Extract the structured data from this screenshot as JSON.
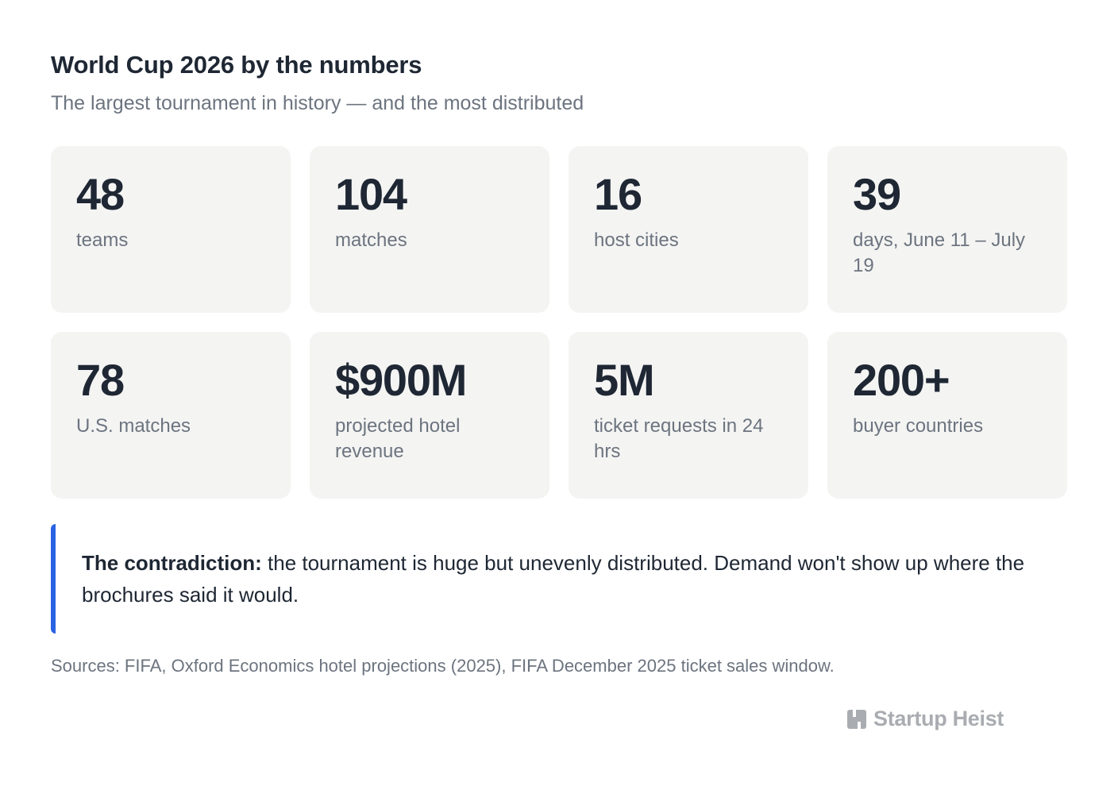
{
  "header": {
    "title": "World Cup 2026 by the numbers",
    "subtitle": "The largest tournament in history — and the most distributed"
  },
  "stats": [
    {
      "value": "48",
      "label": "teams"
    },
    {
      "value": "104",
      "label": "matches"
    },
    {
      "value": "16",
      "label": "host cities"
    },
    {
      "value": "39",
      "label": "days, June 11 – July 19"
    },
    {
      "value": "78",
      "label": "U.S. matches"
    },
    {
      "value": "$900M",
      "label": "projected hotel revenue"
    },
    {
      "value": "5M",
      "label": "ticket requests in 24 hrs"
    },
    {
      "value": "200+",
      "label": "buyer countries"
    }
  ],
  "callout": {
    "lead": "The contradiction:",
    "text": " the tournament is huge but unevenly distributed. Demand won't show up where the brochures said it would."
  },
  "sources": "Sources: FIFA, Oxford Economics hotel projections (2025), FIFA December 2025 ticket sales window.",
  "brand": {
    "name": "Startup Heist",
    "icon": "startup-heist-logo-icon"
  },
  "colors": {
    "text_primary": "#1e2733",
    "text_secondary": "#6c747f",
    "card_background": "#f4f4f3",
    "accent": "#2a63e3",
    "brand_gray": "#a9acb1"
  }
}
